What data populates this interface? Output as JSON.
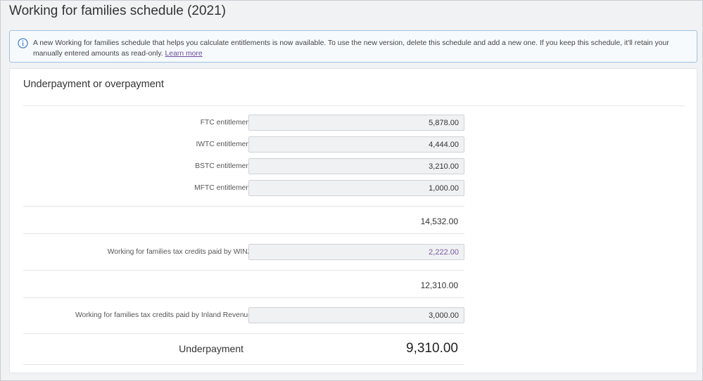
{
  "page": {
    "title": "Working for families schedule (2021)"
  },
  "banner": {
    "icon": "info-icon",
    "text": "A new Working for families schedule that helps you calculate entitlements is now available. To use the new version, delete this schedule and add a new one. If you keep this schedule, it'll retain your manually entered amounts as read-only.",
    "link": "Learn more",
    "border_color": "#9fc3e3"
  },
  "section": {
    "title": "Underpayment or overpayment"
  },
  "entitlements": [
    {
      "label": "FTC entitlement",
      "value": "5,878.00"
    },
    {
      "label": "IWTC entitlement",
      "value": "4,444.00"
    },
    {
      "label": "BSTC entitlement",
      "value": "3,210.00"
    },
    {
      "label": "MFTC entitlement",
      "value": "1,000.00"
    }
  ],
  "entitlement_total": "14,532.00",
  "winz": {
    "label": "Working for families tax credits paid by WINZ",
    "value": "2,222.00",
    "value_color": "#7a5a9e"
  },
  "after_winz_total": "12,310.00",
  "ird": {
    "label": "Working for families tax credits paid by Inland Revenue",
    "value": "3,000.00"
  },
  "result": {
    "label": "Underpayment",
    "value": "9,310.00"
  }
}
